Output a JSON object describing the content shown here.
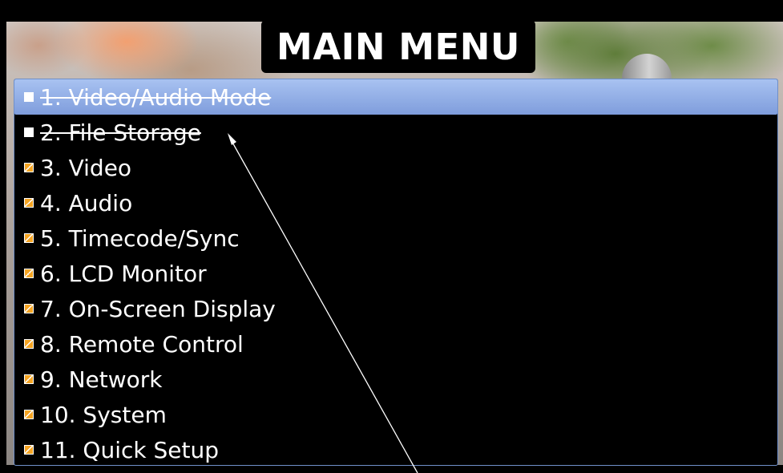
{
  "title": "MAIN MENU",
  "menu_items": [
    {
      "label": "1. Video/Audio Mode",
      "checked": false,
      "disabled": true,
      "selected": true
    },
    {
      "label": "2. File Storage",
      "checked": false,
      "disabled": true,
      "selected": false
    },
    {
      "label": "3. Video",
      "checked": true,
      "disabled": false,
      "selected": false
    },
    {
      "label": "4. Audio",
      "checked": true,
      "disabled": false,
      "selected": false
    },
    {
      "label": "5. Timecode/Sync",
      "checked": true,
      "disabled": false,
      "selected": false
    },
    {
      "label": "6. LCD Monitor",
      "checked": true,
      "disabled": false,
      "selected": false
    },
    {
      "label": "7. On-Screen Display",
      "checked": true,
      "disabled": false,
      "selected": false
    },
    {
      "label": "8. Remote Control",
      "checked": true,
      "disabled": false,
      "selected": false
    },
    {
      "label": "9. Network",
      "checked": true,
      "disabled": false,
      "selected": false
    },
    {
      "label": "10. System",
      "checked": true,
      "disabled": false,
      "selected": false
    },
    {
      "label": "11. Quick Setup",
      "checked": true,
      "disabled": false,
      "selected": false
    }
  ],
  "colors": {
    "highlight": "#8fabe6",
    "checkbox_accent": "#f6a523",
    "panel_border": "#6f8fc9"
  },
  "icons": {
    "checked": "checkbox-checked-icon",
    "unchecked": "checkbox-unchecked-icon"
  }
}
